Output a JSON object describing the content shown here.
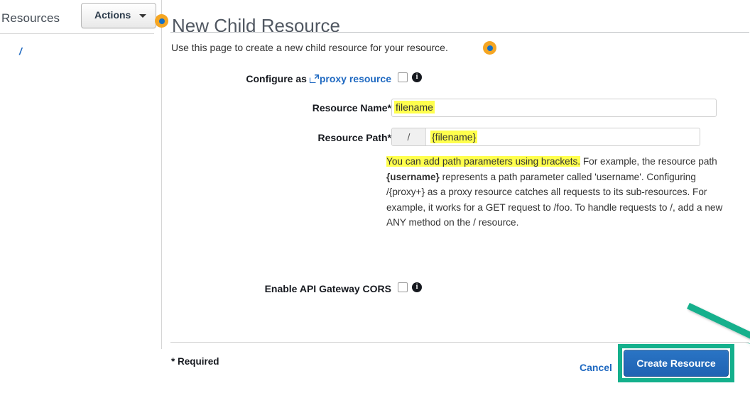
{
  "sidebar": {
    "title": "Resources",
    "actions_button": "Actions",
    "caret_icon": "chevron-down-icon",
    "tree_items": [
      {
        "label": "/"
      }
    ]
  },
  "content": {
    "page_title": "New Child Resource",
    "intro_text": "Use this page to create a new child resource for your resource.",
    "markers": [
      {
        "name": "cursor-marker-title",
        "color": "#f5a623",
        "inner_color": "#1570c6"
      },
      {
        "name": "cursor-marker-intro",
        "color": "#f5a623",
        "inner_color": "#1570c6"
      }
    ],
    "form": {
      "proxy_row": {
        "label_prefix": "Configure as ",
        "link_text": "proxy resource",
        "link_icon": "external-link-icon",
        "checkbox_checked": false,
        "info_icon": "info-icon"
      },
      "resource_name": {
        "label": "Resource Name",
        "required_marker": "*",
        "value": "filename",
        "placeholder": ""
      },
      "resource_path": {
        "label": "Resource Path",
        "required_marker": "*",
        "prefix": "/",
        "value": "{filename}"
      },
      "help": {
        "highlighted_sentence": "You can add path parameters using brackets.",
        "rest_1": " For example, the resource path ",
        "bold_1": "{username}",
        "rest_2": " represents a path parameter called 'username'. Configuring /{proxy+} as a proxy resource catches all requests to its sub-resources. For example, it works for a GET request to /foo. To handle requests to /, add a new ANY method on the / resource."
      },
      "cors_row": {
        "label": "Enable API Gateway CORS",
        "checkbox_checked": false,
        "info_icon": "info-icon"
      }
    },
    "footer": {
      "required_note": "* Required",
      "cancel_label": "Cancel",
      "create_label": "Create Resource"
    }
  },
  "annotations": {
    "arrow_color": "#14b08c",
    "highlight_box_color": "#14b08c"
  }
}
